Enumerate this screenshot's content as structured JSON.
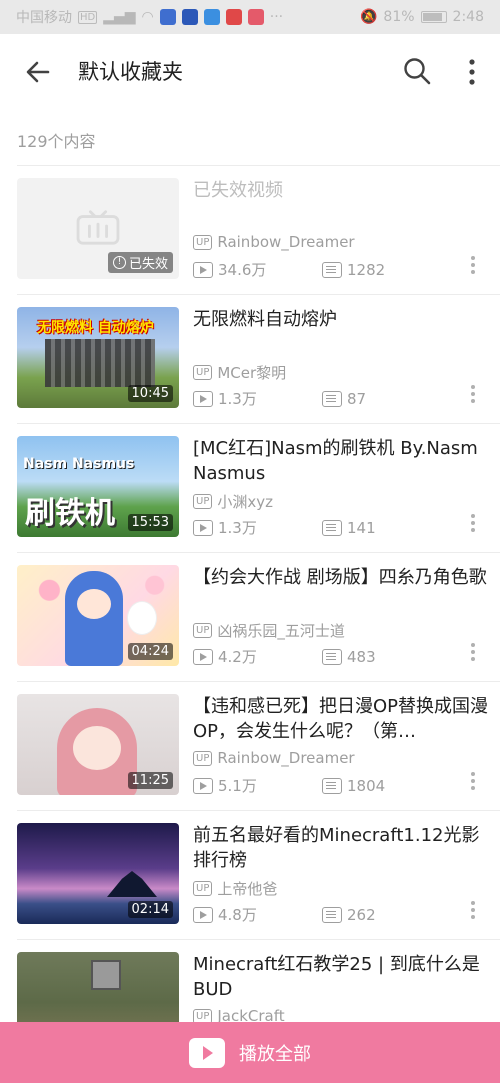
{
  "status_bar": {
    "carrier": "中国移动",
    "hd": "HD",
    "battery": "81%",
    "time": "2:48",
    "app_colors": [
      "#3f6ecf",
      "#2c58b8",
      "#3b8fe0",
      "#e04848",
      "#e45a6a"
    ]
  },
  "toolbar": {
    "back_icon": "back-arrow-icon",
    "title": "默认收藏夹",
    "search_icon": "search-icon",
    "more_icon": "more-vertical-icon"
  },
  "count_label": "129个内容",
  "items": [
    {
      "title": "已失效视频",
      "uploader": "Rainbow_Dreamer",
      "views": "34.6万",
      "danmaku": "1282",
      "expired_label": "已失效",
      "invalid": true
    },
    {
      "title": "无限燃料自动熔炉",
      "uploader": "MCer黎明",
      "views": "1.3万",
      "danmaku": "87",
      "duration": "10:45",
      "thumb_text": "无限燃料 自动熔炉"
    },
    {
      "title": "[MC红石]Nasm的刷铁机 By.Nasm Nasmus",
      "uploader": "小渊xyz",
      "views": "1.3万",
      "danmaku": "141",
      "duration": "15:53",
      "thumb_text_top": "Nasm Nasmus",
      "thumb_text_big": "刷铁机"
    },
    {
      "title": "【约会大作战 剧场版】四糸乃角色歌",
      "uploader": "凶祸乐园_五河士道",
      "views": "4.2万",
      "danmaku": "483",
      "duration": "04:24"
    },
    {
      "title": "【违和感已死】把日漫OP替换成国漫OP，会发生什么呢？（第…",
      "uploader": "Rainbow_Dreamer",
      "views": "5.1万",
      "danmaku": "1804",
      "duration": "11:25"
    },
    {
      "title": "前五名最好看的Minecraft1.12光影排行榜",
      "uploader": "上帝他爸",
      "views": "4.8万",
      "danmaku": "262",
      "duration": "02:14"
    },
    {
      "title": "Minecraft红石教学25 | 到底什么是BUD",
      "uploader": "JackCraft",
      "views": "",
      "danmaku": ""
    }
  ],
  "up_badge": "UP",
  "play_all_label": "播放全部",
  "colors": {
    "accent": "#f07aa0",
    "muted": "#9e9e9e"
  }
}
